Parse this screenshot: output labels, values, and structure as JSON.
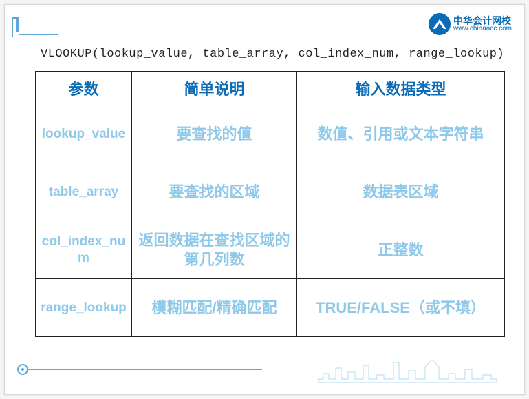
{
  "logo": {
    "cn": "中华会计网校",
    "url": "www.chinaacc.com"
  },
  "formula": "VLOOKUP(lookup_value,  table_array,   col_index_num,  range_lookup)",
  "table": {
    "headers": [
      "参数",
      "简单说明",
      "输入数据类型"
    ],
    "rows": [
      {
        "param": "lookup_value",
        "desc": "要查找的值",
        "type": "数值、引用或文本字符串"
      },
      {
        "param": "table_array",
        "desc": "要查找的区域",
        "type": "数据表区域"
      },
      {
        "param": "col_index_num",
        "desc": "返回数据在查找区域的第几列数",
        "type": "正整数"
      },
      {
        "param": "range_lookup",
        "desc": "模糊匹配/精确匹配",
        "type": "TRUE/FALSE（或不填）"
      }
    ]
  }
}
